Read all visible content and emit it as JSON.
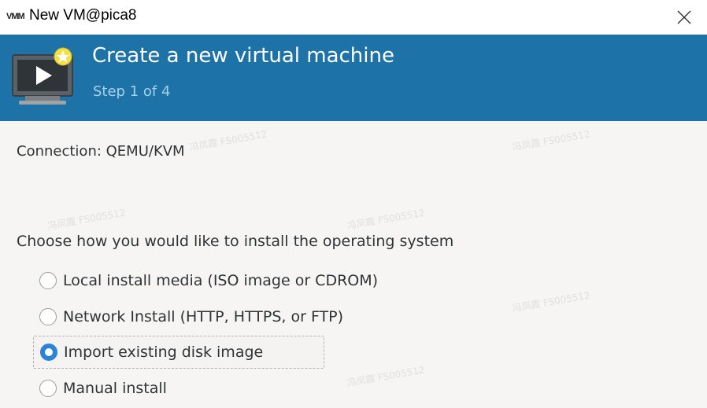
{
  "window": {
    "app_icon_text": "VMM",
    "title": "New VM@pica8",
    "close_glyph": "✕"
  },
  "header": {
    "title": "Create a new virtual machine",
    "step": "Step 1 of 4",
    "icon": "vm-monitor-icon",
    "background_color": "#1d72a8"
  },
  "connection": {
    "text": "Connection: QEMU/KVM"
  },
  "install": {
    "question": "Choose how you would like to install the operating system",
    "options": [
      {
        "label": "Local install media (ISO image or CDROM)",
        "selected": false
      },
      {
        "label": "Network Install (HTTP, HTTPS, or FTP)",
        "selected": false
      },
      {
        "label": "Import existing disk image",
        "selected": true
      },
      {
        "label": "Manual install",
        "selected": false
      }
    ]
  },
  "watermark": {
    "text": "冯凤霞 FS005512"
  }
}
